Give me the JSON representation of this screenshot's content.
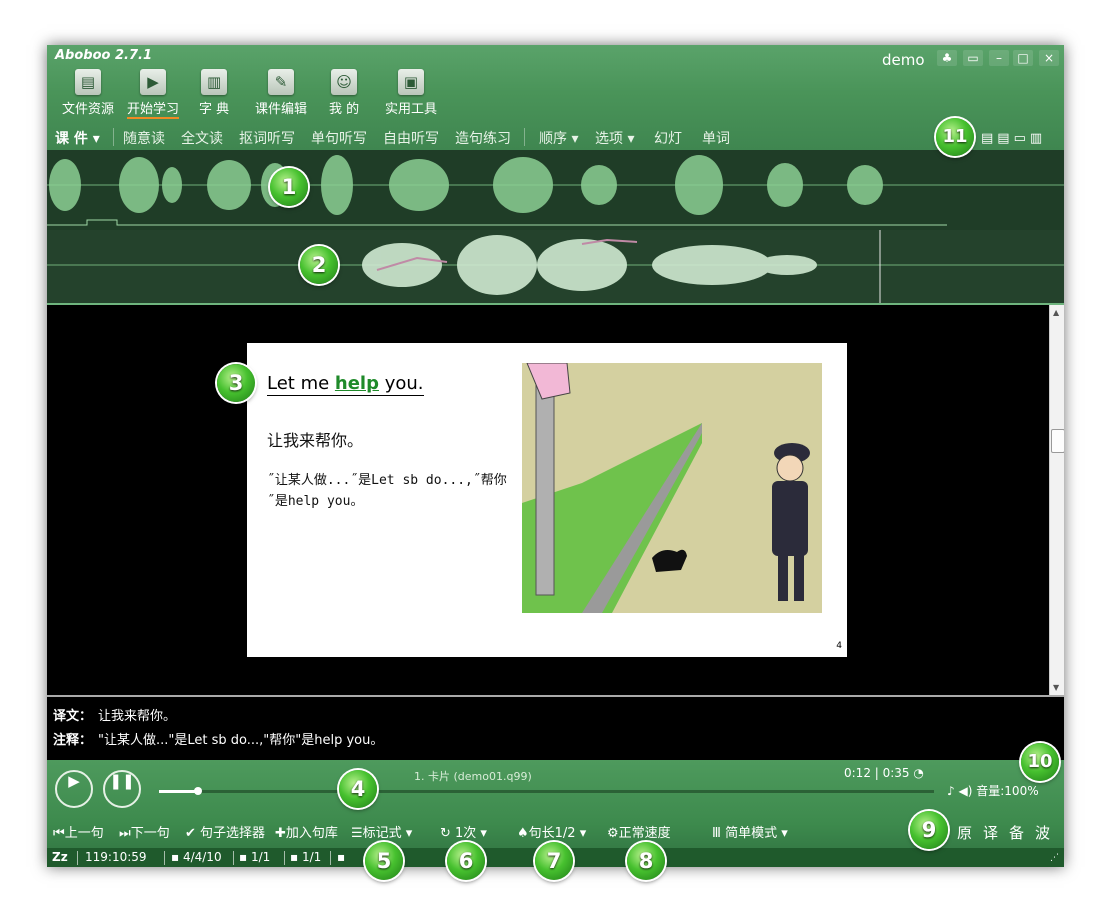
{
  "app": {
    "title": "Aboboo 2.7.1",
    "user": "demo"
  },
  "toolbar": [
    {
      "label": "文件资源",
      "icon": "file-resource-icon"
    },
    {
      "label": "开始学习",
      "icon": "play-icon",
      "active": true
    },
    {
      "label": "字 典",
      "icon": "dictionary-icon"
    },
    {
      "label": "课件编辑",
      "icon": "edit-icon"
    },
    {
      "label": "我 的",
      "icon": "user-icon"
    },
    {
      "label": "实用工具",
      "icon": "toolbox-icon"
    }
  ],
  "menu": {
    "courseware": "课 件 ▾",
    "items": [
      "随意读",
      "全文读",
      "抠词听写",
      "单句听写",
      "自由听写",
      "造句练习"
    ],
    "right_items": [
      "顺序 ▾",
      "选项 ▾",
      "幻灯",
      "单词"
    ]
  },
  "slide": {
    "headline_pre": "Let me ",
    "headline_highlight": "help",
    "headline_post": " you",
    "headline_end": ".",
    "translation": "让我来帮你。",
    "note": "˝让某人做...˝是Let sb do...,˝帮你˝是help you。",
    "page": "4"
  },
  "text_panel": {
    "translation_label": "译文：",
    "translation": "让我来帮你。",
    "note_label": "注释：",
    "note": "\"让某人做...\"是Let sb do...,\"帮你\"是help you。"
  },
  "player": {
    "file_info": "1. 卡片 (demo01.q99)",
    "time": "0:12 | 0:35",
    "progress": 0.05,
    "volume": "音量:100%"
  },
  "controls": {
    "prev": "⏮上一句",
    "next": "⏭下一句",
    "selector": "✔ 句子选择器",
    "add": "✚加入句库",
    "mark_style": "标记式 ▾",
    "repeat": "↻ 1次 ▾",
    "length": "句长1/2 ▾",
    "speed": "正常速度",
    "mode": "简单模式 ▾",
    "right": [
      "原",
      "译",
      "备",
      "波"
    ]
  },
  "status": [
    "Zz",
    "119:10:59",
    "▪ 4/4/10",
    "▪ 1/1",
    "▪ 1/1",
    "▪"
  ],
  "badges": [
    "1",
    "2",
    "3",
    "4",
    "5",
    "6",
    "7",
    "8",
    "9",
    "10",
    "11"
  ],
  "colors": {
    "window": "#3f8a52",
    "accent": "#f08a24",
    "highlight": "#1f8a2a",
    "badge": "#47c12f"
  }
}
